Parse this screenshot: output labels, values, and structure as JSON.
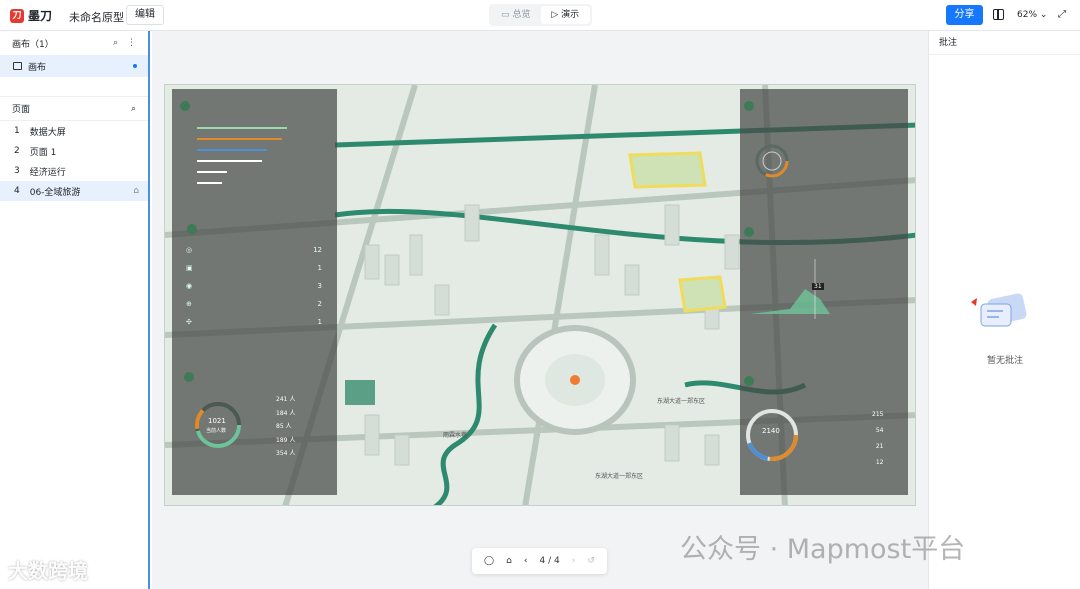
{
  "app": {
    "logo_text": "墨刀",
    "project_name": "未命名原型",
    "edit_label": "编辑"
  },
  "modes": [
    {
      "label": "总览",
      "active": false
    },
    {
      "label": "演示",
      "active": true
    }
  ],
  "toolbar": {
    "share_label": "分享",
    "zoom": "62%"
  },
  "left_panel": {
    "canvas_header": "画布（1）",
    "canvas_item": "画布",
    "pages_header": "页面",
    "pages": [
      {
        "num": "1",
        "label": "数据大屏"
      },
      {
        "num": "2",
        "label": "页面 1"
      },
      {
        "num": "3",
        "label": "经济运行"
      },
      {
        "num": "4",
        "label": "06-全域旅游"
      }
    ]
  },
  "map_labels": {
    "loc1": "东湖大道一郑东区",
    "loc2": "东湖大道一郑东区",
    "loc3": "雨霖水巷"
  },
  "dashboard": {
    "panel_iot_values": [
      "12",
      "1",
      "3",
      "2",
      "1"
    ],
    "visitors_ring_value": "1021",
    "visitors_ring_label": "当前人数",
    "visitor_counts": [
      "241 人",
      "184 人",
      "85 人",
      "189 人",
      "354 人"
    ],
    "spend_ring_value": "2140",
    "spend_values": [
      "215",
      "54",
      "21",
      "12"
    ],
    "safety_peak": "31"
  },
  "bottom_toolbar": {
    "page_indicator": "4 / 4"
  },
  "right_panel": {
    "title": "批注",
    "empty_text": "暂无批注"
  },
  "watermarks": {
    "left": "大数跨境",
    "right": "公众号 · Mapmost平台"
  }
}
